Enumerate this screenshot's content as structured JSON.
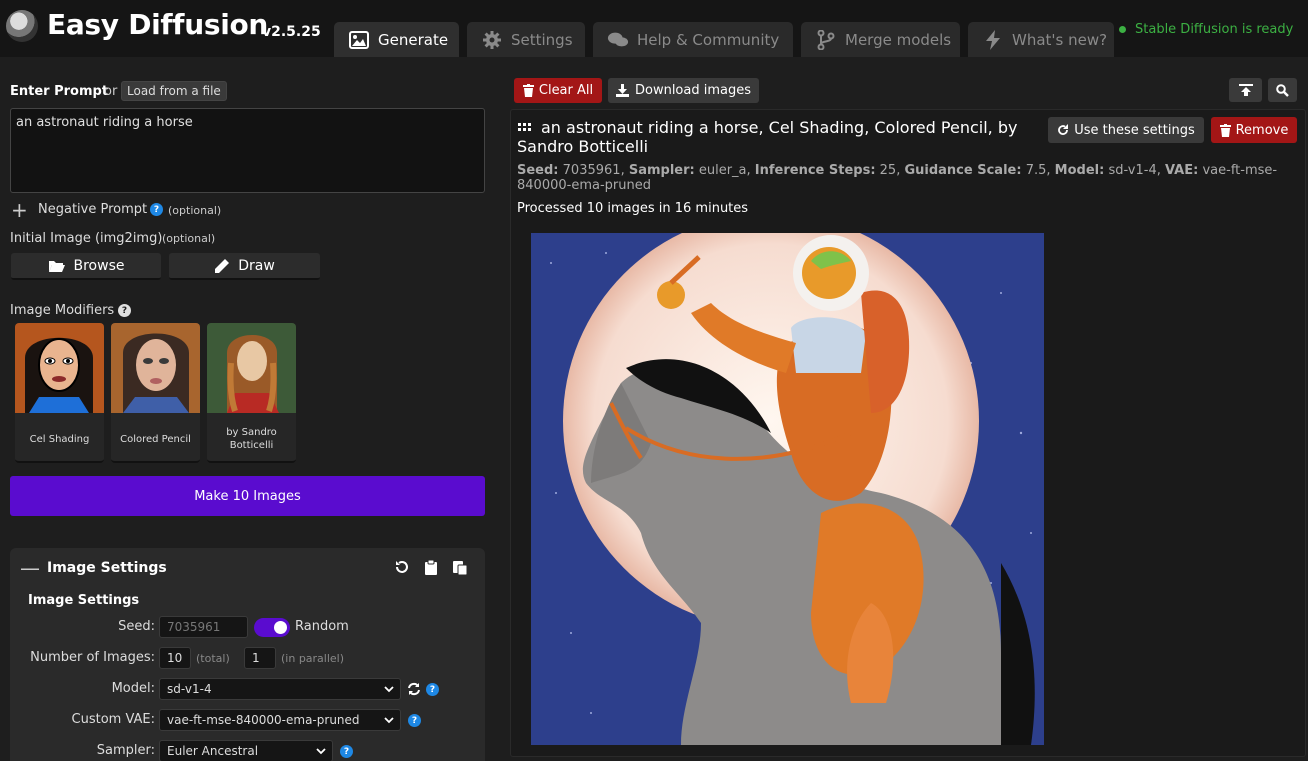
{
  "app": {
    "title": "Easy Diffusion",
    "version": "v2.5.25",
    "status": "Stable Diffusion is ready",
    "status_color": "#3cb043",
    "accent": "#5a0ccf",
    "danger": "#a31616"
  },
  "tabs": [
    {
      "label": "Generate",
      "icon": "image-icon",
      "active": true
    },
    {
      "label": "Settings",
      "icon": "gear-icon",
      "active": false
    },
    {
      "label": "Help & Community",
      "icon": "comments-icon",
      "active": false
    },
    {
      "label": "Merge models",
      "icon": "code-branch-icon",
      "active": false
    },
    {
      "label": "What's new?",
      "icon": "bolt-icon",
      "active": false
    }
  ],
  "prompt": {
    "label": "Enter Prompt",
    "or": "or",
    "load_button": "Load from a file",
    "value": "an astronaut riding a horse"
  },
  "negative_prompt": {
    "label": "Negative Prompt",
    "optional": "(optional)"
  },
  "initial_image": {
    "label": "Initial Image (img2img)",
    "optional": "(optional)",
    "browse": "Browse",
    "draw": "Draw"
  },
  "modifiers": {
    "label": "Image Modifiers",
    "items": [
      {
        "label": "Cel Shading"
      },
      {
        "label": "Colored Pencil"
      },
      {
        "label": "by Sandro Botticelli"
      }
    ]
  },
  "make_button": "Make 10 Images",
  "image_settings": {
    "panel_title": "Image Settings",
    "section_title": "Image Settings",
    "seed_label": "Seed:",
    "seed_value": "7035961",
    "random_label": "Random",
    "random_on": true,
    "num_images_label": "Number of Images:",
    "num_total": "10",
    "total_label": "(total)",
    "num_parallel": "1",
    "parallel_label": "(in parallel)",
    "model_label": "Model:",
    "model_value": "sd-v1-4",
    "vae_label": "Custom VAE:",
    "vae_value": "vae-ft-mse-840000-ema-pruned",
    "sampler_label": "Sampler:",
    "sampler_value": "Euler Ancestral"
  },
  "toolbar": {
    "clear_all": "Clear All",
    "download": "Download images"
  },
  "result": {
    "prompt": "an astronaut riding a horse, Cel Shading, Colored Pencil, by Sandro Botticelli",
    "use_settings": "Use these settings",
    "remove": "Remove",
    "meta": {
      "seed_label": "Seed:",
      "seed": "7035961",
      "sampler_label": "Sampler:",
      "sampler": "euler_a",
      "steps_label": "Inference Steps:",
      "steps": "25",
      "guidance_label": "Guidance Scale:",
      "guidance": "7.5",
      "model_label": "Model:",
      "model": "sd-v1-4",
      "vae_label": "VAE:",
      "vae": "vae-ft-mse-840000-ema-pruned"
    },
    "processed": "Processed 10 images in 16 minutes"
  }
}
